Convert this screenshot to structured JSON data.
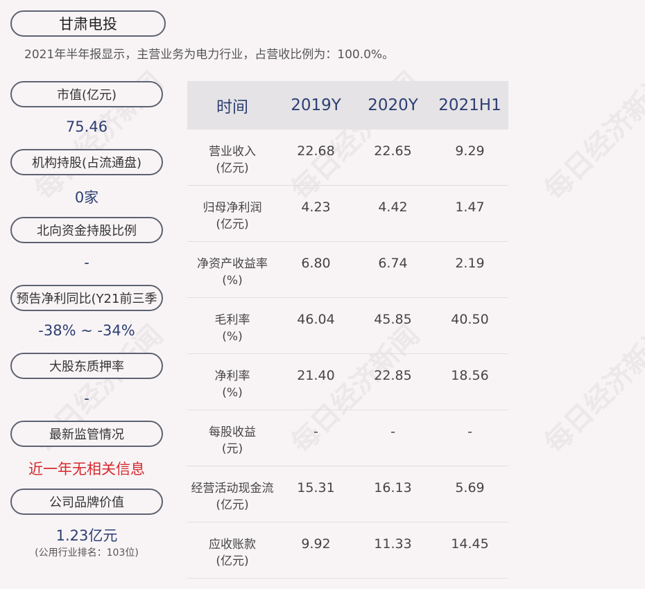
{
  "company": "甘肃电投",
  "summary": "2021年半年报显示，主营业务为电力行业，占营收比例为：100.0%。",
  "watermark": "每日经济新闻",
  "metrics": [
    {
      "label": "市值(亿元)",
      "value": "75.46"
    },
    {
      "label": "机构持股(占流通盘)",
      "value": "0家"
    },
    {
      "label": "北向资金持股比例",
      "value": "-"
    },
    {
      "label": "预告净利同比(Y21前三季",
      "value": "-38% ~ -34%"
    },
    {
      "label": "大股东质押率",
      "value": "-"
    },
    {
      "label": "最新监管情况",
      "value": "近一年无相关信息"
    },
    {
      "label": "公司品牌价值",
      "value": "1.23亿元",
      "sub": "(公用行业排名：103位)"
    }
  ],
  "table": {
    "headers": [
      "时间",
      "2019Y",
      "2020Y",
      "2021H1"
    ],
    "rows": [
      {
        "label1": "营业收入",
        "label2": "(亿元)",
        "v": [
          "22.68",
          "22.65",
          "9.29"
        ]
      },
      {
        "label1": "归母净利润",
        "label2": "(亿元)",
        "v": [
          "4.23",
          "4.42",
          "1.47"
        ]
      },
      {
        "label1": "净资产收益率",
        "label2": "(%)",
        "v": [
          "6.80",
          "6.74",
          "2.19"
        ]
      },
      {
        "label1": "毛利率",
        "label2": "(%)",
        "v": [
          "46.04",
          "45.85",
          "40.50"
        ]
      },
      {
        "label1": "净利率",
        "label2": "(%)",
        "v": [
          "21.40",
          "22.85",
          "18.56"
        ]
      },
      {
        "label1": "每股收益",
        "label2": "(元)",
        "v": [
          "-",
          "-",
          "-"
        ]
      },
      {
        "label1": "经营活动现金流",
        "label2": "(亿元)",
        "v": [
          "15.31",
          "16.13",
          "5.69"
        ]
      },
      {
        "label1": "应收账款",
        "label2": "(亿元)",
        "v": [
          "9.92",
          "11.33",
          "14.45"
        ]
      }
    ]
  },
  "colors": {
    "accent": "#2c3e73",
    "alert": "#d7282e",
    "header_bg": "#e5e3e5",
    "page_bg": "#f8f4f5"
  }
}
